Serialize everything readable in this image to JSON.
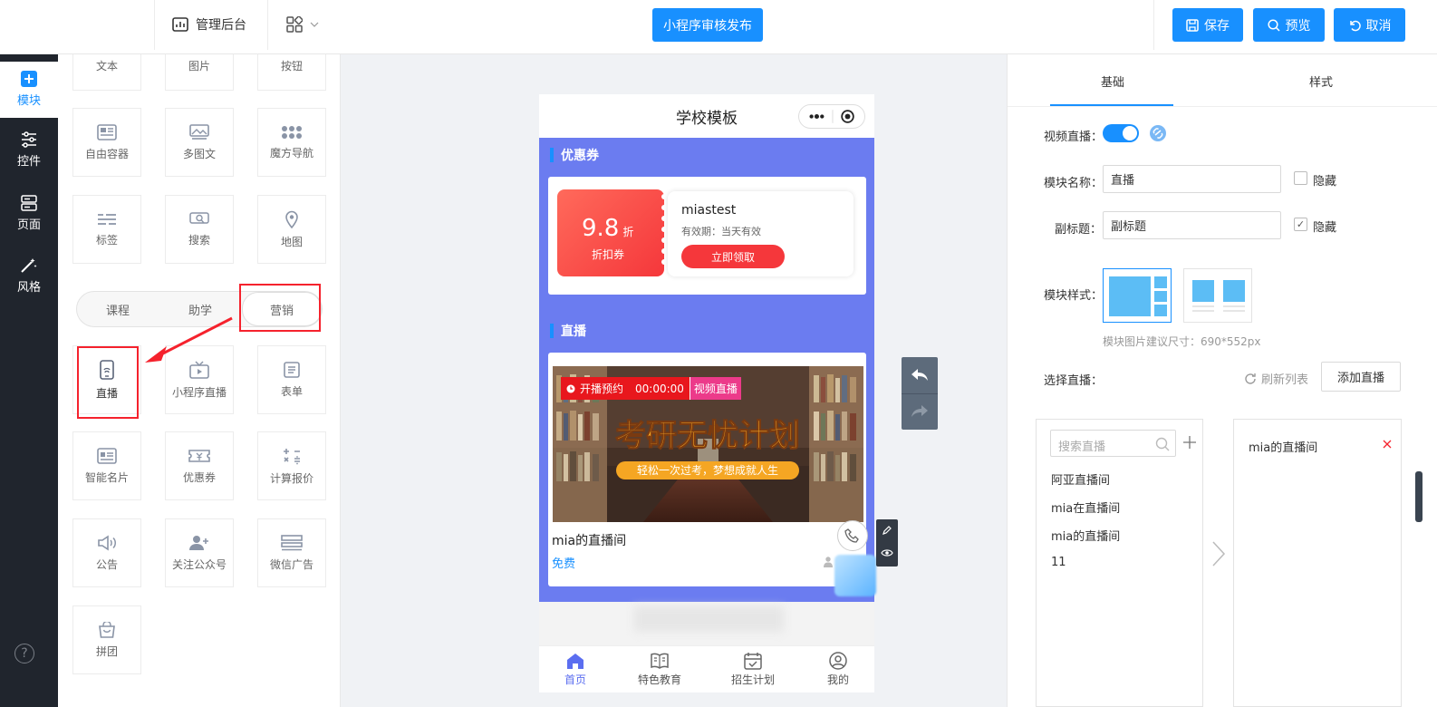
{
  "topbar": {
    "admin_label": "管理后台",
    "publish_label": "小程序审核发布",
    "save_label": "保存",
    "preview_label": "预览",
    "cancel_label": "取消"
  },
  "sidebar": {
    "items": [
      {
        "label": "模块",
        "icon": "plus-square-icon",
        "active": true
      },
      {
        "label": "控件",
        "icon": "sliders-icon"
      },
      {
        "label": "页面",
        "icon": "pages-icon"
      },
      {
        "label": "风格",
        "icon": "magic-wand-icon"
      }
    ],
    "help": "?"
  },
  "components": {
    "row0": [
      "文本",
      "图片",
      "按钮"
    ],
    "row1": [
      "自由容器",
      "多图文",
      "魔方导航"
    ],
    "row2": [
      "标签",
      "搜索",
      "地图"
    ],
    "tabs": [
      "课程",
      "助学",
      "营销"
    ],
    "active_tab": "营销",
    "row3": [
      "直播",
      "小程序直播",
      "表单"
    ],
    "row4": [
      "智能名片",
      "优惠券",
      "计算报价"
    ],
    "row5": [
      "公告",
      "关注公众号",
      "微信广告"
    ],
    "row6": [
      "拼团"
    ]
  },
  "phone": {
    "title": "学校模板",
    "coupon_section": "优惠券",
    "coupon": {
      "value": "9.8",
      "unit": "折",
      "type": "折扣券",
      "name": "miastest",
      "validity": "有效期：当天有效",
      "button": "立即领取"
    },
    "live_section": "直播",
    "live": {
      "badge_status": "开播预约",
      "badge_time": "00:00:00",
      "badge_type": "视频直播",
      "image_headline": "考研无忧计划",
      "image_slogan": "轻松一次过考，梦想成就人生",
      "name": "mia的直播间",
      "price": "免费"
    },
    "tabbar": [
      "首页",
      "特色教育",
      "招生计划",
      "我的"
    ]
  },
  "settings": {
    "tabs": [
      "基础",
      "样式"
    ],
    "video_live_label": "视频直播：",
    "video_live_on": true,
    "module_name_label": "模块名称：",
    "module_name_value": "直播",
    "hide_label": "隐藏",
    "subtitle_label": "副标题：",
    "subtitle_value": "副标题",
    "subtitle_hidden": true,
    "module_style_label": "模块样式：",
    "image_hint": "模块图片建议尺寸：690*552px",
    "select_live_label": "选择直播：",
    "refresh_label": "刷新列表",
    "add_live_label": "添加直播",
    "search_placeholder": "搜索直播",
    "live_list": [
      "阿亚直播间",
      "mia在直播间",
      "mia的直播间",
      "11"
    ],
    "selected_list": [
      "mia的直播间"
    ]
  },
  "colors": {
    "primary": "#1890ff",
    "sidebar_bg": "#20252d",
    "phone_section_bg": "#6b7cf0",
    "coupon_red": "#f5373b",
    "highlight_red": "#f5222d"
  }
}
